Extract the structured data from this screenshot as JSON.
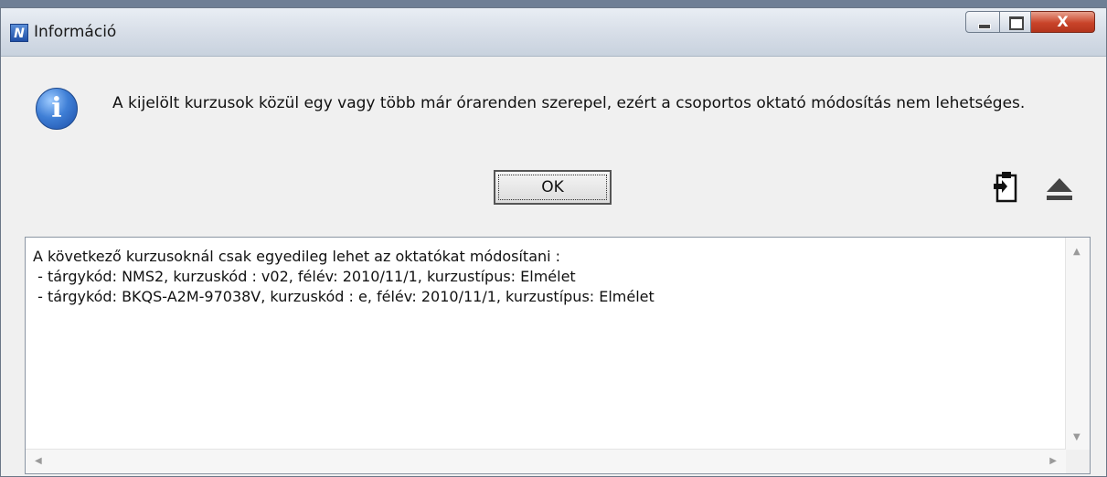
{
  "window": {
    "title": "Információ",
    "app_icon_letter": "N",
    "close_glyph": "X"
  },
  "dialog": {
    "icon": "info-icon",
    "message": "A kijelölt kurzusok közül egy vagy több már órarenden szerepel, ezért a csoportos oktató módosítás nem lehetséges.",
    "ok_label": "OK"
  },
  "details": {
    "lines": [
      "A következő kurzusoknál csak egyedileg lehet az oktatókat módosítani :",
      " - tárgykód: NMS2, kurzuskód : v02, félév: 2010/11/1, kurzustípus: Elmélet",
      " - tárgykód: BKQS-A2M-97038V, kurzuskód : e, félév: 2010/11/1, kurzustípus: Elmélet"
    ]
  }
}
